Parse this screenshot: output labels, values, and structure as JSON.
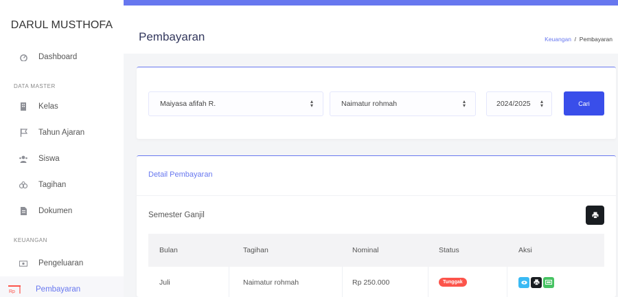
{
  "brand": "DARUL MUSTHOFA",
  "sidebar": {
    "items": [
      {
        "label": "Dashboard",
        "icon": "dashboard-icon"
      },
      {
        "heading": "DATA MASTER"
      },
      {
        "label": "Kelas",
        "icon": "building-icon"
      },
      {
        "label": "Tahun Ajaran",
        "icon": "flag-icon"
      },
      {
        "label": "Siswa",
        "icon": "users-icon"
      },
      {
        "label": "Tagihan",
        "icon": "coins-icon"
      },
      {
        "label": "Dokumen",
        "icon": "file-icon"
      },
      {
        "heading": "KEUANGAN"
      },
      {
        "label": "Pengeluaran",
        "icon": "money-icon"
      },
      {
        "label": "Pembayaran",
        "icon": "payment-icon"
      }
    ]
  },
  "header": {
    "title": "Pembayaran",
    "breadcrumb": {
      "link": "Keuangan",
      "separator": "/",
      "current": "Pembayaran"
    }
  },
  "filters": {
    "student": "Maiyasa afifah R.",
    "guardian": "Naimatur rohmah",
    "year": "2024/2025",
    "search_label": "Cari"
  },
  "detail": {
    "title": "Detail Pembayaran",
    "semester": "Semester Ganjil",
    "columns": [
      "Bulan",
      "Tagihan",
      "Nominal",
      "Status",
      "Aksi"
    ],
    "rows": [
      {
        "bulan": "Juli",
        "tagihan": "Naimatur rohmah",
        "nominal": "Rp 250.000",
        "status": "Tunggak"
      }
    ]
  },
  "colors": {
    "accent": "#6777ef",
    "primary_button": "#394eea",
    "danger": "#fc544b",
    "info": "#3abaf4",
    "success": "#47c363",
    "dark": "#191d21"
  }
}
